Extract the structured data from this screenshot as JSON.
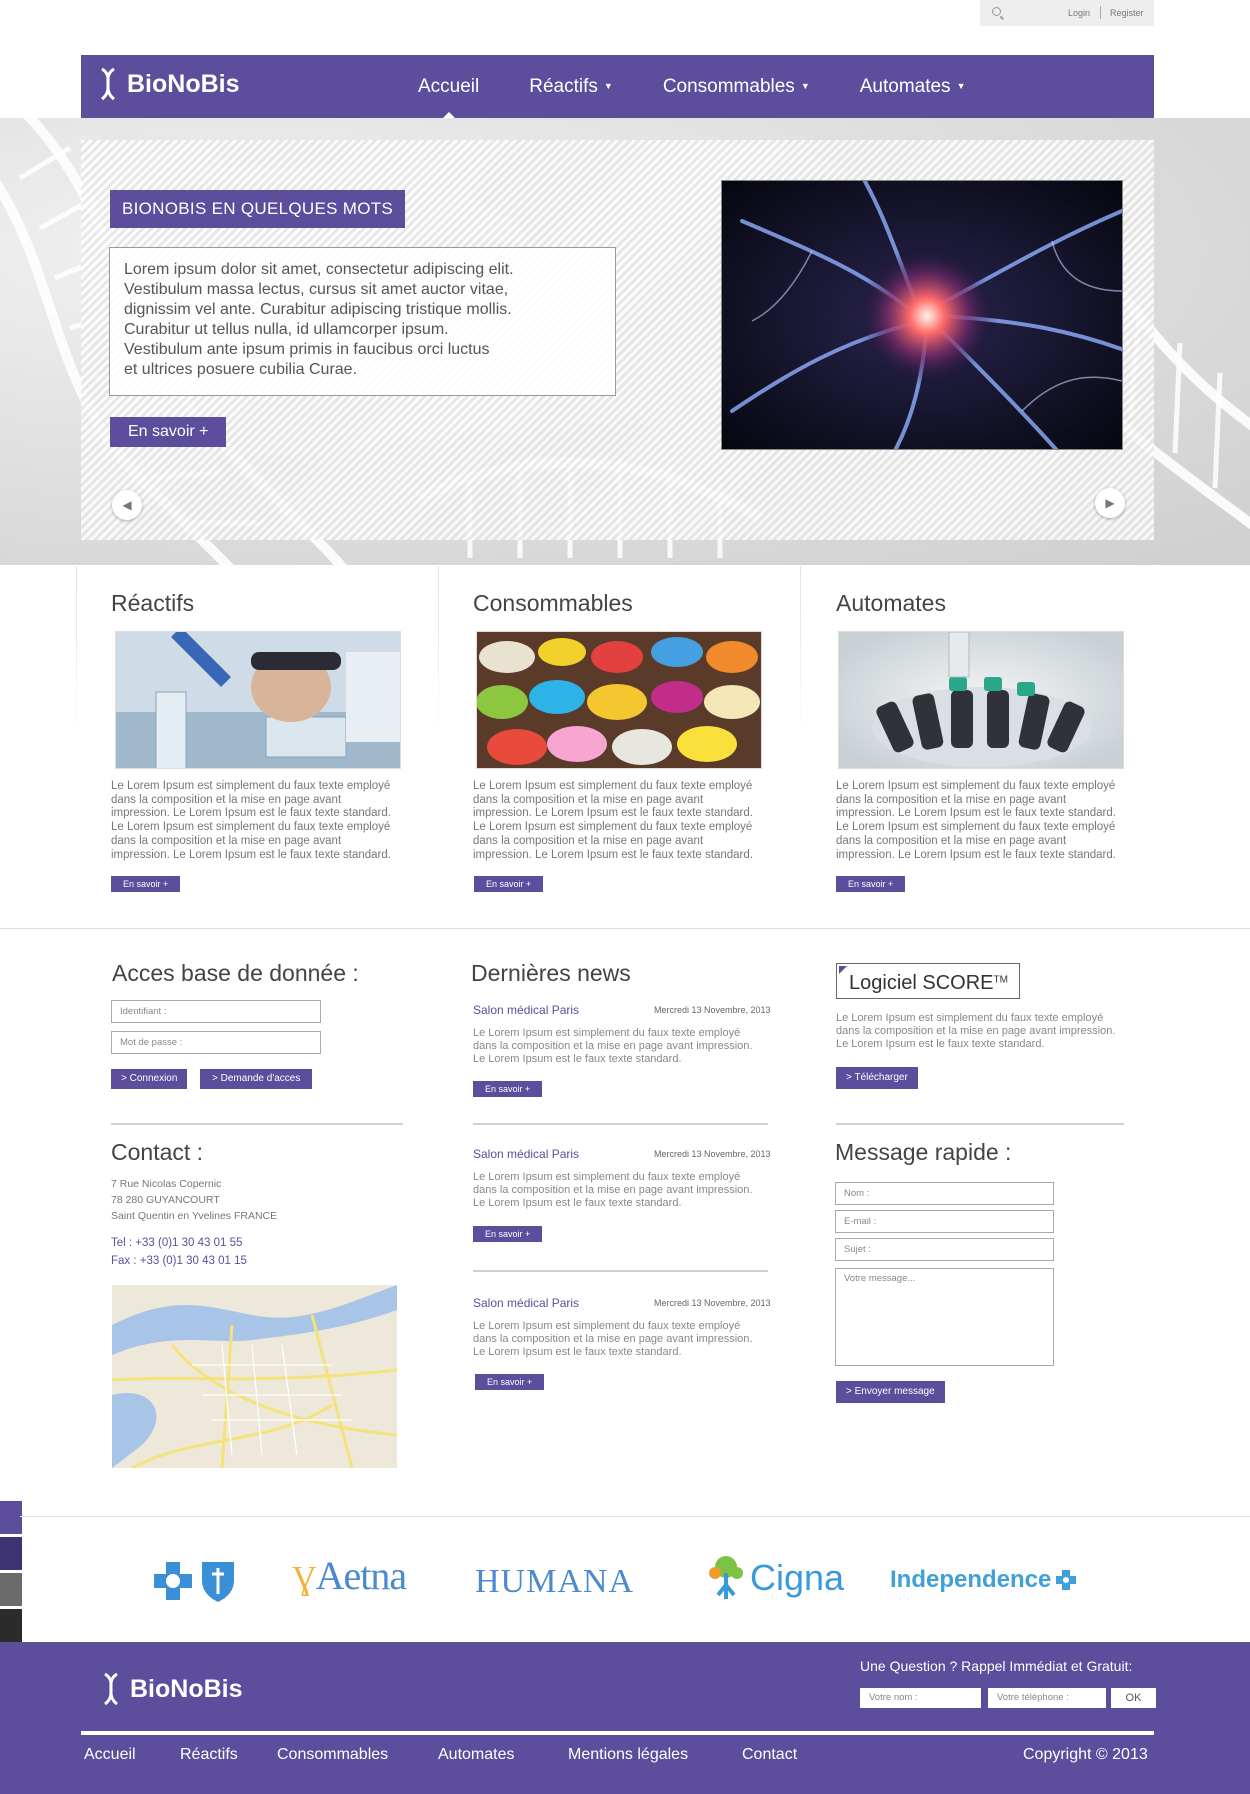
{
  "topbar": {
    "login": "Login",
    "register": "Register"
  },
  "brand": {
    "name": "BioNoBis"
  },
  "nav": {
    "items": [
      {
        "label": "Accueil"
      },
      {
        "label": "Réactifs"
      },
      {
        "label": "Consommables"
      },
      {
        "label": "Automates"
      }
    ]
  },
  "hero": {
    "title": "BIONOBIS EN QUELQUES MOTS",
    "lines": [
      "Lorem ipsum dolor sit amet, consectetur adipiscing elit.",
      "Vestibulum massa lectus, cursus sit amet auctor vitae,",
      "dignissim vel ante. Curabitur adipiscing tristique mollis.",
      "Curabitur ut tellus nulla, id ullamcorper ipsum.",
      "Vestibulum ante ipsum primis in faucibus orci luctus",
      "et ultrices posuere cubilia Curae."
    ],
    "button": "En savoir +",
    "prev_icon": "chevron-left-icon",
    "next_icon": "chevron-right-icon"
  },
  "products": [
    {
      "title": "Réactifs",
      "lines": [
        "Le Lorem Ipsum est simplement du faux texte employé",
        "dans la composition et la mise en page avant",
        "impression. Le Lorem Ipsum est le faux texte standard.",
        "Le Lorem Ipsum est simplement du faux texte employé",
        "dans la composition et la mise en page avant",
        "impression. Le Lorem Ipsum est le faux texte standard."
      ],
      "button": "En savoir +"
    },
    {
      "title": "Consommables",
      "lines": [
        "Le Lorem Ipsum est simplement du faux texte employé",
        "dans la composition et la mise en page avant",
        "impression. Le Lorem Ipsum est le faux texte standard.",
        "Le Lorem Ipsum est simplement du faux texte employé",
        "dans la composition et la mise en page avant",
        "impression. Le Lorem Ipsum est le faux texte standard."
      ],
      "button": "En savoir +"
    },
    {
      "title": "Automates",
      "lines": [
        "Le Lorem Ipsum est simplement du faux texte employé",
        "dans la composition et la mise en page avant",
        "impression. Le Lorem Ipsum est le faux texte standard.",
        "Le Lorem Ipsum est simplement du faux texte employé",
        "dans la composition et la mise en page avant",
        "impression. Le Lorem Ipsum est le faux texte standard."
      ],
      "button": "En savoir +"
    }
  ],
  "database": {
    "title": "Acces base de donnée :",
    "id_placeholder": "Identifiant :",
    "pass_placeholder": "Mot de passe :",
    "connect": "> Connexion",
    "request": "> Demande d'acces"
  },
  "news": {
    "title": "Dernières news",
    "items": [
      {
        "title": "Salon médical Paris",
        "date": "Mercredi 13 Novembre, 2013",
        "lines": [
          "Le Lorem Ipsum est simplement du faux texte employé",
          "dans la composition et la mise en page avant impression.",
          "Le Lorem Ipsum est le faux texte standard."
        ],
        "button": "En savoir +"
      },
      {
        "title": "Salon médical Paris",
        "date": "Mercredi 13 Novembre, 2013",
        "lines": [
          "Le Lorem Ipsum est simplement du faux texte employé",
          "dans la composition et la mise en page avant impression.",
          "Le Lorem Ipsum est le faux texte standard."
        ],
        "button": "En savoir +"
      },
      {
        "title": "Salon médical Paris",
        "date": "Mercredi 13 Novembre, 2013",
        "lines": [
          "Le Lorem Ipsum est simplement du faux texte employé",
          "dans la composition et la mise en page avant impression.",
          "Le Lorem Ipsum est le faux texte standard."
        ],
        "button": "En savoir +"
      }
    ]
  },
  "software": {
    "title": "Logiciel SCORE",
    "tm": "TM",
    "lines": [
      "Le Lorem Ipsum est simplement du faux texte employé",
      "dans la composition et la mise en page avant impression.",
      "Le Lorem Ipsum est le faux texte standard."
    ],
    "button": "> Télécharger"
  },
  "contact": {
    "title": "Contact :",
    "address": [
      "7 Rue Nicolas Copernic",
      "78 280 GUYANCOURT",
      "Saint Quentin en Yvelines FRANCE"
    ],
    "tel": "Tel : +33 (0)1 30 43 01 55",
    "fax": "Fax : +33 (0)1 30 43 01 15"
  },
  "message": {
    "title": "Message rapide :",
    "name_placeholder": "Nom :",
    "email_placeholder": "E-mail :",
    "subject_placeholder": "Sujet :",
    "message_placeholder": "Votre message...",
    "send": "> Envoyer message"
  },
  "partners": {
    "aetna": "Aetna",
    "humana": "HUMANA",
    "cigna": "Cigna",
    "independence": "Independence"
  },
  "footer": {
    "question": "Une Question ? Rappel Immédiat et Gratuit:",
    "name_placeholder": "Votre nom :",
    "phone_placeholder": "Votre téléphone :",
    "ok": "OK",
    "links": [
      "Accueil",
      "Réactifs",
      "Consommables",
      "Automates",
      "Mentions légales",
      "Contact"
    ],
    "copyright": "Copyright © 2013"
  },
  "colors": {
    "accent": "#5c4e9c",
    "text": "#555555",
    "link": "#5c4e9c"
  }
}
